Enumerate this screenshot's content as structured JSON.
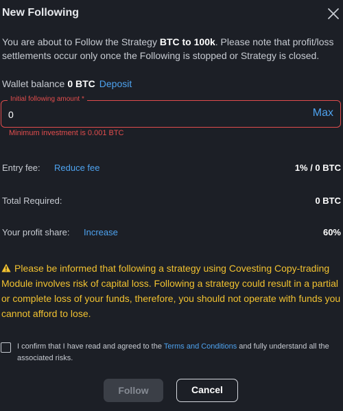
{
  "dialog": {
    "title": "New Following",
    "close_icon": "close-icon"
  },
  "intro": {
    "text_before": "You are about to Follow the Strategy ",
    "strategy_name": "BTC to 100k",
    "text_after": ". Please note that profit/loss settlements occur only once the Following is stopped or Strategy is closed."
  },
  "wallet": {
    "label": "Wallet balance",
    "balance": "0 BTC",
    "deposit_label": "Deposit"
  },
  "amount_field": {
    "label": "Initial following amount *",
    "value": "0",
    "max_label": "Max",
    "error": "Minimum investment is 0.001 BTC"
  },
  "entry_fee": {
    "label": "Entry fee:",
    "link": "Reduce fee",
    "value": "1% / 0 BTC"
  },
  "total_required": {
    "label": "Total Required:",
    "value": "0 BTC"
  },
  "profit_share": {
    "label": "Your profit share:",
    "link": "Increase",
    "value": "60%"
  },
  "warning": {
    "icon": "warning-icon",
    "text": "Please be informed that following a strategy using Covesting Copy-trading Module involves risk of capital loss. Following a strategy could result in a partial or complete loss of your funds, therefore, you should not operate with funds you cannot afford to lose."
  },
  "confirm": {
    "checked": false,
    "text_before": "I confirm that I have read and agreed to the ",
    "terms_link": "Terms and Conditions",
    "text_after": " and fully understand all the associated risks."
  },
  "buttons": {
    "follow_label": "Follow",
    "cancel_label": "Cancel"
  },
  "colors": {
    "background": "#1c1f26",
    "accent": "#4ea3f0",
    "error": "#e24d4d",
    "warning": "#f2c230"
  }
}
